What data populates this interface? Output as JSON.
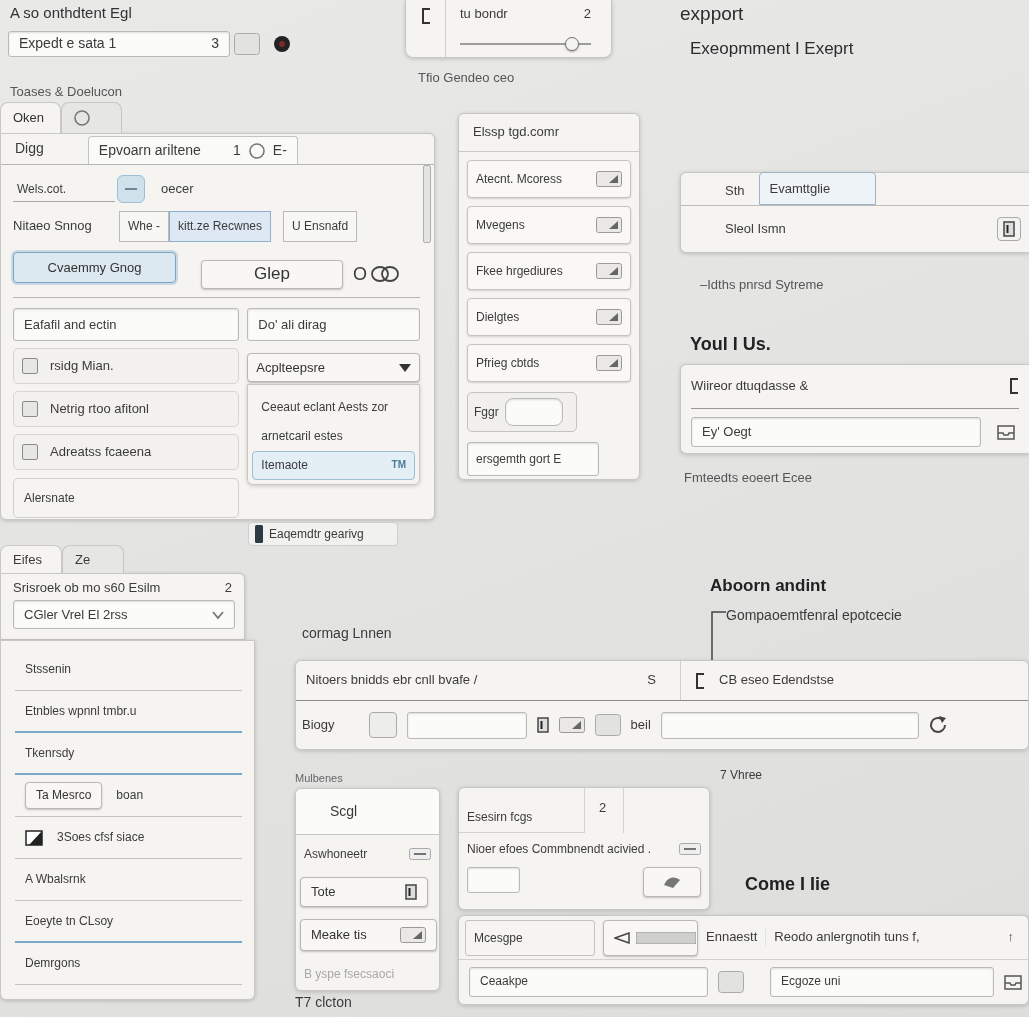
{
  "header": {
    "title": "A so onthdtent Egl",
    "field": {
      "value": "Expedt e sata 1",
      "count": "3"
    }
  },
  "top_card": {
    "label": "tu bondr",
    "count": "2",
    "slider": {
      "level": 0.9
    },
    "caption": "Tfio Gendeo ceo"
  },
  "export": {
    "title": "expport",
    "subtitle": "Exeopmment I Exeprt"
  },
  "section_title": "Toases & Doelucon",
  "outer_tabs": [
    {
      "kind": "text",
      "label": "Oken",
      "selected": true
    },
    {
      "kind": "icon",
      "selected": false
    }
  ],
  "dialog": {
    "tabs": [
      {
        "label": "Digg",
        "selected": false
      },
      {
        "label": "Epvoarn ariltene",
        "count": "1",
        "shortcut": "E-",
        "selected": true
      }
    ],
    "switch_row": {
      "label": "Wels.cot.",
      "checked": true,
      "text": "oecer"
    },
    "segment_row": {
      "label": "Nitaeo Snnog",
      "segments": [
        {
          "label": "Whe -",
          "selected": false
        },
        {
          "label": "kitt.ze Recwnes",
          "selected": true
        },
        {
          "label": "U Ensnafd",
          "selected": false
        }
      ]
    },
    "buttons": [
      {
        "label": "Cvaemmy Gnog",
        "selected": true
      },
      {
        "label": "Glep",
        "selected": false
      }
    ],
    "trailing_text": "O",
    "left_field": "Eafafil and ectin",
    "checkboxes": [
      {
        "label": "rsidg Mian.",
        "checked": false
      },
      {
        "label": "Netrig rtoo afitonl",
        "checked": false
      },
      {
        "label": "Adreatss fcaeena",
        "checked": false
      }
    ],
    "footer_item": "Alersnate",
    "right_field": "Do' ali dirag",
    "dropdown": {
      "value": "Acplteepsre",
      "menu": [
        {
          "label": "Ceeaut eclant Aests zor",
          "selected": false
        },
        {
          "label": "arnetcaril estes",
          "selected": false
        },
        {
          "label": "Itemaote",
          "shortcut": "TM",
          "selected": true
        }
      ]
    }
  },
  "chip": "Eaqemdtr gearivg",
  "list_panel": {
    "title": "Elssp tgd.comr",
    "items": [
      {
        "label": "Atecnt. Mcoress"
      },
      {
        "label": "Mvegens"
      },
      {
        "label": "Fkee hrgediures"
      },
      {
        "label": "Dielgtes"
      },
      {
        "label": "Pfrieg cbtds"
      }
    ],
    "toggle_label": "Fggr",
    "bottom_field": "ersgemth gort E"
  },
  "tab_panel": {
    "tabs": [
      {
        "label": "Sth",
        "selected": false
      },
      {
        "label": "Evamttglie",
        "selected": true
      }
    ],
    "row_label": "Sleol Ismn",
    "caption": "–Idths pnrsd Sytreme"
  },
  "profile": {
    "title": "Youl I Us.",
    "row_label": "Wiireor dtuqdasse &",
    "field_value": "Ey' Oegt",
    "caption": "Fmteedts eoeert Ecee"
  },
  "side_tabs": [
    {
      "label": "Eifes",
      "selected": true
    },
    {
      "label": "Ze",
      "selected": false
    }
  ],
  "side_header": {
    "title": "Srisroek ob mo s60 Esilm",
    "count": "2",
    "select_value": "CGler Vrel El 2rss"
  },
  "side_list": [
    {
      "kind": "text",
      "label": "Stssenin",
      "highlighted": false
    },
    {
      "kind": "text",
      "label": "Etnbles wpnnl tmbr.u",
      "highlighted": true
    },
    {
      "kind": "text",
      "label": "Tkenrsdy",
      "highlighted": true
    },
    {
      "kind": "button",
      "label": "Ta Mesrco",
      "note": "boan",
      "highlighted": false
    },
    {
      "kind": "icon",
      "label": "3Soes cfsf siace",
      "highlighted": false
    },
    {
      "kind": "text",
      "label": "A Wbalsrnk",
      "highlighted": false
    },
    {
      "kind": "text",
      "label": "Eoeyte tn CLsoy",
      "highlighted": true
    },
    {
      "kind": "text",
      "label": "Demrgons",
      "highlighted": false
    }
  ],
  "form_caption": "cormag Lnnen",
  "about": {
    "title": "Aboorn andint",
    "note": "Gompaoemtfenral epotcecie"
  },
  "form": {
    "description": "Nitoers bnidds ebr cnll bvafe /",
    "count": "S",
    "right_label": "CB eseo Edendstse",
    "row_label": "Biogy",
    "checked": false,
    "middle_label": "beil"
  },
  "form_note": "7 Vhree",
  "tools": {
    "caption": "Mulbenes",
    "header": "Scgl",
    "label": "Aswhoneetr",
    "buttons": [
      {
        "label": "Tote"
      },
      {
        "label": "Meake tis"
      }
    ],
    "disabled_item": "B yspe fsecsaoci",
    "footer": "T7 clcton"
  },
  "message": {
    "tab": "Esesirn fcgs",
    "count": "2",
    "text": "Nioer efoes Commbnendt acivied ."
  },
  "footer_title": "Come I Iie",
  "footer_row": {
    "label": "Mcesgpe",
    "status": "Ennaestt",
    "text": "Reodo anlergnotih tuns f,",
    "arrow": "↑",
    "field_1": "Ceaakpe",
    "field_2": "Ecgoze uni"
  }
}
